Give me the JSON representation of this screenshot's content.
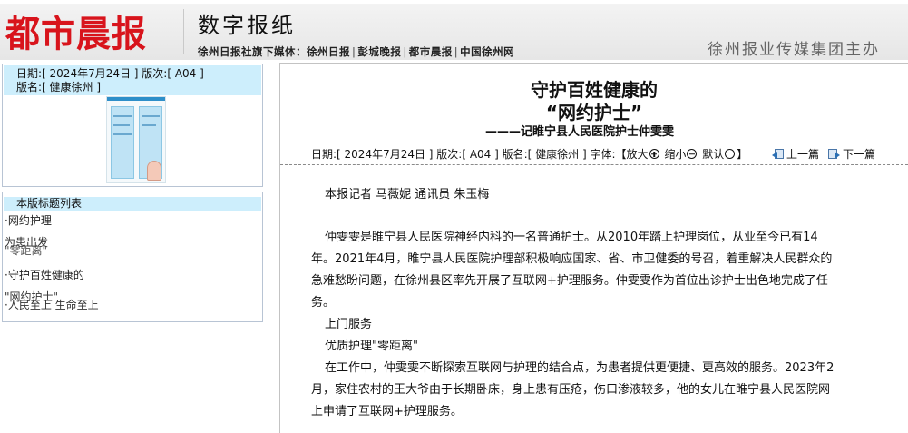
{
  "header": {
    "logo": "都市晨报",
    "site_title": "数字报纸",
    "sub_nav_prefix": "徐州日报社旗下媒体：",
    "sub_nav_links": [
      "徐州日报",
      "彭城晚报",
      "都市晨报",
      "中国徐州网"
    ],
    "publisher": "徐州报业传媒集团主办",
    "colors": {
      "logo": "#d8141c",
      "info_box": "#cdeefc"
    }
  },
  "sidebar": {
    "date_label": "日期:[ 2024年7月24日 ] 版次:[ A04 ]",
    "edition_label": "版名:[ 健康徐州 ]",
    "thumbnail_icon": "newspaper-page-icon",
    "list_header": "本版标题列表",
    "items": [
      {
        "label": "·网约护理",
        "overflow_a": "为患",
        "overflow_b": "\"零距离\"",
        "overflow_mid": "出发"
      },
      {
        "label": "·守护百姓健康的",
        "overflow_a": "\"网约护士\"",
        "overflow_b": "·人民至上 生命至上"
      }
    ]
  },
  "article": {
    "title_line1": "守护百姓健康的",
    "title_line2": "“网约护士”",
    "subtitle": "———记睢宁县人民医院护士仲雯雯",
    "meta": {
      "info": "日期:[ 2024年7月24日 ] 版次:[ A04 ] 版名:[ 健康徐州 ] 字体:【",
      "zoom_in": "放大",
      "zoom_out": "缩小",
      "default": "默认",
      "close_bracket": "】",
      "prev": "上一篇",
      "next": "下一篇"
    },
    "byline": "本报记者 马薇妮 通讯员 朱玉梅",
    "paragraph1": [
      "仲雯雯是睢宁县人民医院神经内科的一名普通护士。从2010年踏上护理岗位，从业至今已有14",
      "年。2021年4月，睢宁县人民医院护理部积极响应国家、省、市卫健委的号召，着重解决人民群众的",
      "急难愁盼问题，在徐州县区率先开展了互联网+护理服务。仲雯雯作为首位出诊护士出色地完成了任",
      "务。"
    ],
    "section_heading1": "上门服务",
    "section_heading2": "优质护理\"零距离\"",
    "paragraph2": [
      "在工作中，仲雯雯不断探索互联网与护理的结合点，为患者提供更便捷、更高效的服务。2023年2",
      "月，家住农村的王大爷由于长期卧床，身上患有压疮，伤口渗液较多，他的女儿在睢宁县人民医院网",
      "上申请了互联网+护理服务。"
    ]
  }
}
